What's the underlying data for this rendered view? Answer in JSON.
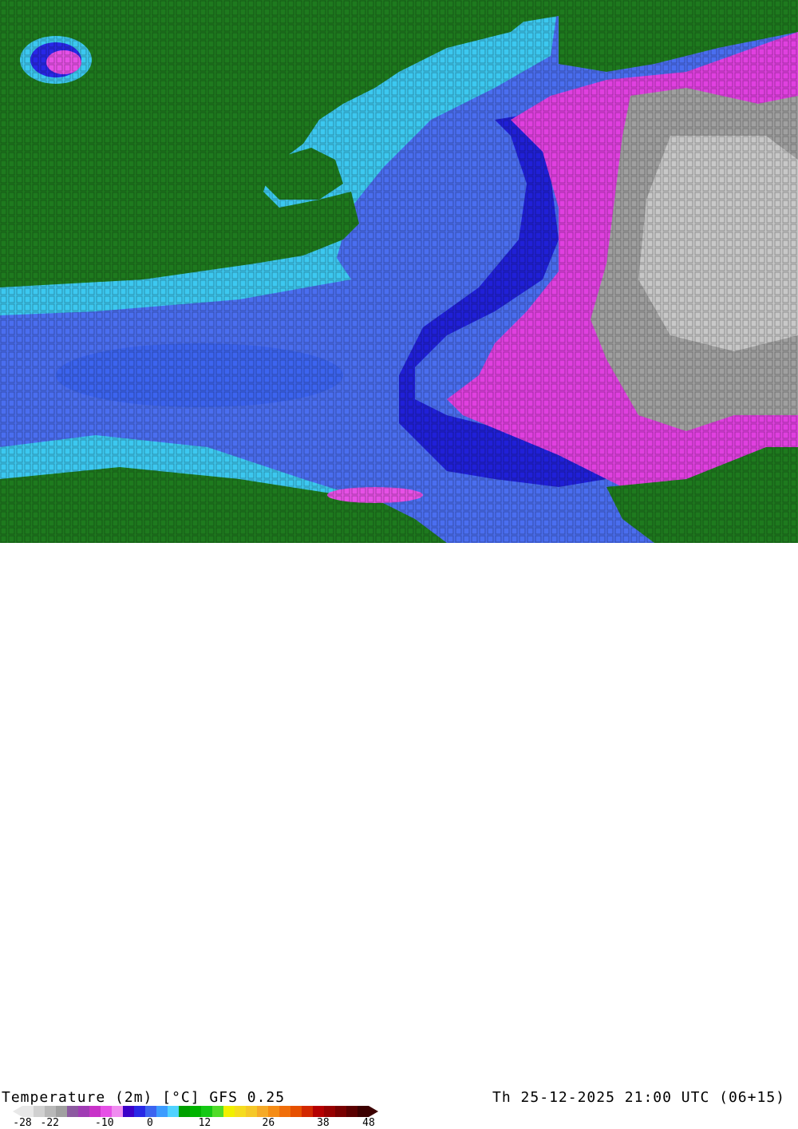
{
  "title": {
    "left": "Temperature (2m) [°C] GFS 0.25",
    "right": "Th 25-12-2025 21:00 UTC (06+15)"
  },
  "legend": {
    "ticks": [
      "-28",
      "-22",
      "-10",
      "0",
      "12",
      "26",
      "38",
      "48"
    ],
    "tick_values": [
      -28,
      -22,
      -10,
      0,
      12,
      26,
      38,
      48
    ],
    "min": -28,
    "max": 48,
    "colors": [
      "#e8e8e8",
      "#d0d0d0",
      "#b8b8b8",
      "#a0a0a0",
      "#8c5aa0",
      "#a03cb4",
      "#c832c8",
      "#e650e6",
      "#f08cf0",
      "#3c00c8",
      "#2828e6",
      "#3c64f0",
      "#3c9cff",
      "#50d2ff",
      "#00a000",
      "#00b400",
      "#14c814",
      "#50dc28",
      "#f0f000",
      "#f5dc1e",
      "#f5c828",
      "#f5aa28",
      "#f58c14",
      "#f06e0a",
      "#e65000",
      "#d22800",
      "#b40000",
      "#960000",
      "#780000",
      "#5a0000",
      "#3c0000"
    ]
  },
  "palette": {
    "land_green": "#1e7a1e",
    "water_cyan": "#3cc8f0",
    "water_blue": "#4a6ef0",
    "cold_blue": "#2020d8",
    "magenta": "#e040e0",
    "grey": "#a0a0a0",
    "grid": "#000000"
  }
}
